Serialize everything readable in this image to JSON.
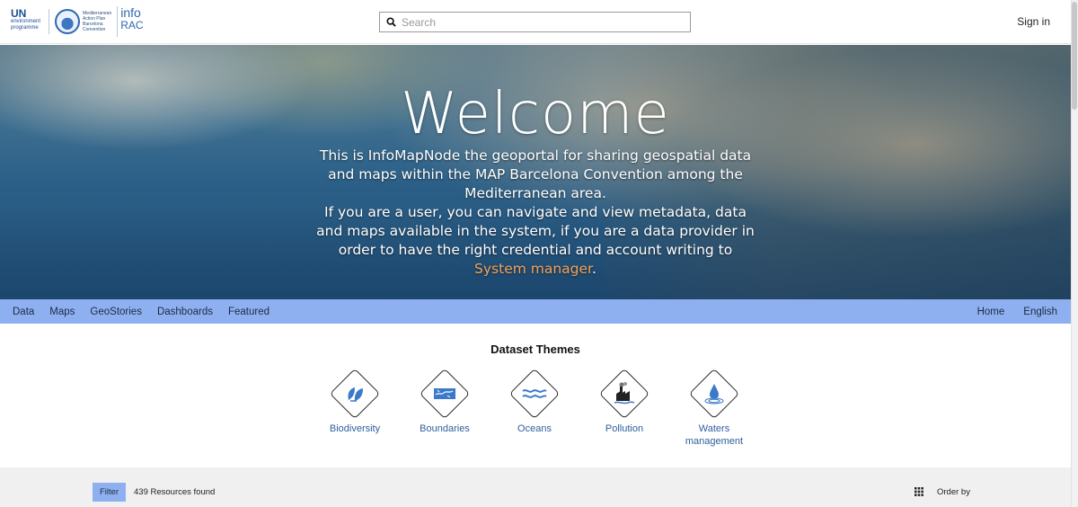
{
  "header": {
    "logo_un_line1": "UN",
    "logo_un_line2": "environment",
    "logo_un_line3": "programme",
    "logo_map_line1": "Mediterranean",
    "logo_map_line2": "Action Plan",
    "logo_map_line3": "Barcelona",
    "logo_map_line4": "Convention",
    "logo_info_line1": "info",
    "logo_info_line2": "RAC",
    "search_placeholder": "Search",
    "sign_in_label": "Sign in"
  },
  "hero": {
    "title": "Welcome",
    "intro_text": "This is InfoMapNode the geoportal for sharing geospatial data and maps within the MAP Barcelona Convention among the Mediterranean area.",
    "intro_text2": "If you are a user, you can navigate and view metadata, data and maps available in the system, if you are a data provider in order to have the right credential and account writing to ",
    "system_manager_link": "System manager",
    "period": "."
  },
  "menu": {
    "left_items": [
      "Data",
      "Maps",
      "GeoStories",
      "Dashboards",
      "Featured"
    ],
    "right_items": [
      "Home",
      "English"
    ]
  },
  "themes": {
    "title": "Dataset Themes",
    "items": [
      {
        "label": "Biodiversity",
        "icon": "leaf-icon"
      },
      {
        "label": "Boundaries",
        "icon": "map-icon"
      },
      {
        "label": "Oceans",
        "icon": "waves-icon"
      },
      {
        "label": "Pollution",
        "icon": "factory-icon"
      },
      {
        "label": "Waters management",
        "icon": "water-drop-icon"
      }
    ]
  },
  "toolbar": {
    "filter_label": "Filter",
    "resources_found": "439 Resources found",
    "order_by_label": "Order by"
  },
  "colors": {
    "menu_bar": "#8fb0f0",
    "link_blue": "#2f5f9e",
    "accent_orange": "#f3a35b"
  }
}
